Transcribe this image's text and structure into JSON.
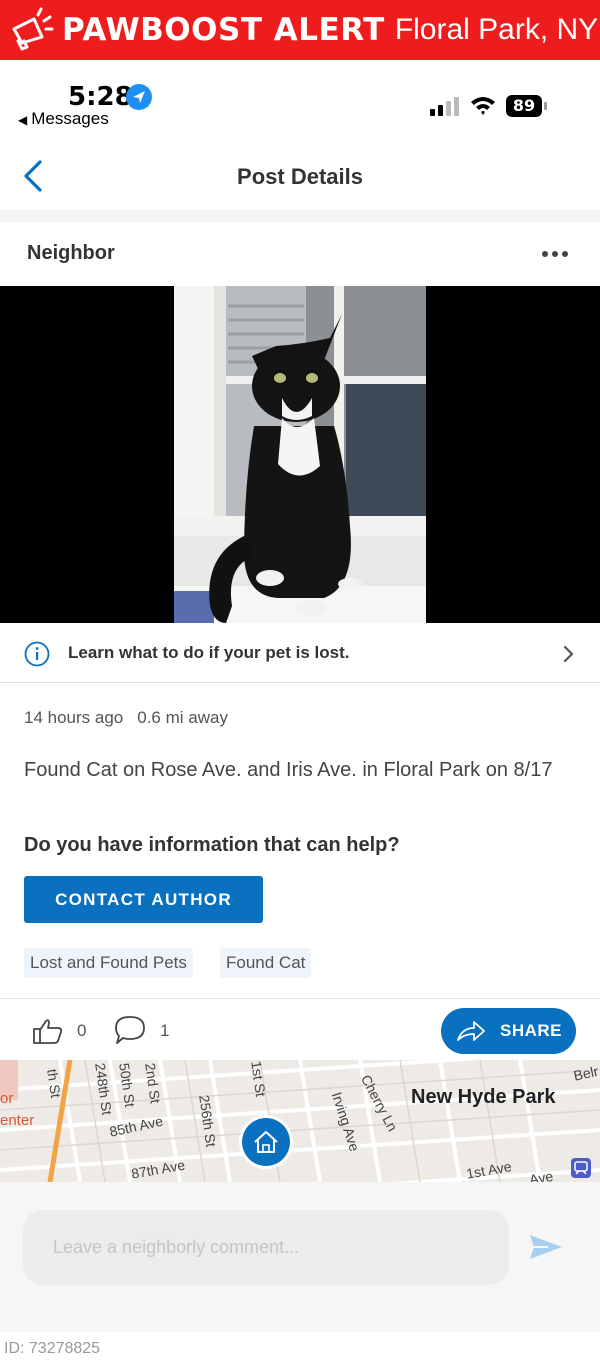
{
  "banner": {
    "brand": "PAWBOOST ALERT",
    "location": "Floral Park, NY",
    "color": "#ee1c1c"
  },
  "status_bar": {
    "time": "5:28",
    "back_app": "Messages",
    "battery": "89"
  },
  "nav": {
    "title": "Post Details"
  },
  "post": {
    "author": "Neighbor",
    "info_text": "Learn what to do if your pet is lost.",
    "time_ago": "14 hours ago",
    "distance": "0.6 mi away",
    "body": "Found Cat  on Rose Ave. and Iris Ave. in Floral Park on 8/17",
    "help_question": "Do you have information that can help?",
    "contact_label": "CONTACT AUTHOR",
    "tags": [
      "Lost and Found Pets",
      "Found Cat"
    ],
    "likes": "0",
    "comments": "1",
    "share_label": "SHARE"
  },
  "map": {
    "labels": [
      "th St",
      "248th St",
      "50th St",
      "2nd St",
      "256th St",
      "1st St",
      "Irving Ave",
      "Cherry Ln",
      "New Hyde Park",
      "85th Ave",
      "87th Ave",
      "1st Ave",
      "Ave",
      "Belr",
      "or",
      "enter"
    ]
  },
  "comment": {
    "placeholder": "Leave a neighborly comment..."
  },
  "footer": {
    "id": "ID: 73278825"
  },
  "colors": {
    "primary": "#0a70c0",
    "alert_red": "#ee1c1c"
  }
}
